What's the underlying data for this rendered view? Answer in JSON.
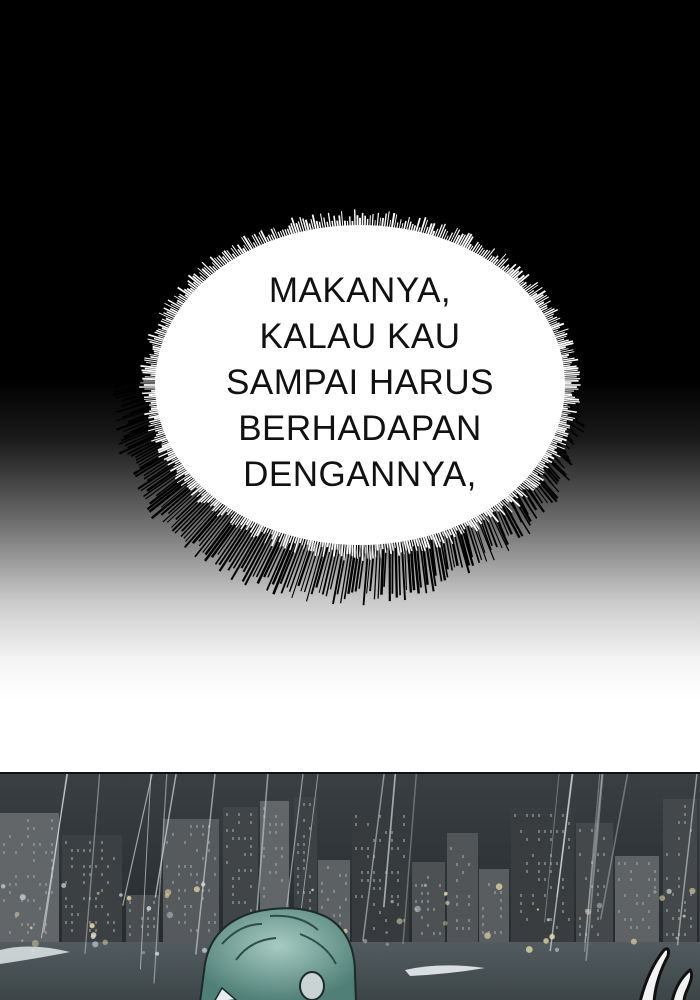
{
  "speech_bubble": {
    "lines": [
      "MAKANYA,",
      "KALAU KAU",
      "SAMPAI HARUS",
      "BERHADAPAN",
      "DENGANNYA,"
    ]
  },
  "colors": {
    "bubble_fill": "#ffffff",
    "bubble_outline": "#000000",
    "night_sky": "#2a3034",
    "water": "#4a5457",
    "hair": "#6f9e94"
  },
  "scene": {
    "setting": "rainy night city skyline by the water",
    "character": "figure with teal hair at bottom of panel"
  }
}
